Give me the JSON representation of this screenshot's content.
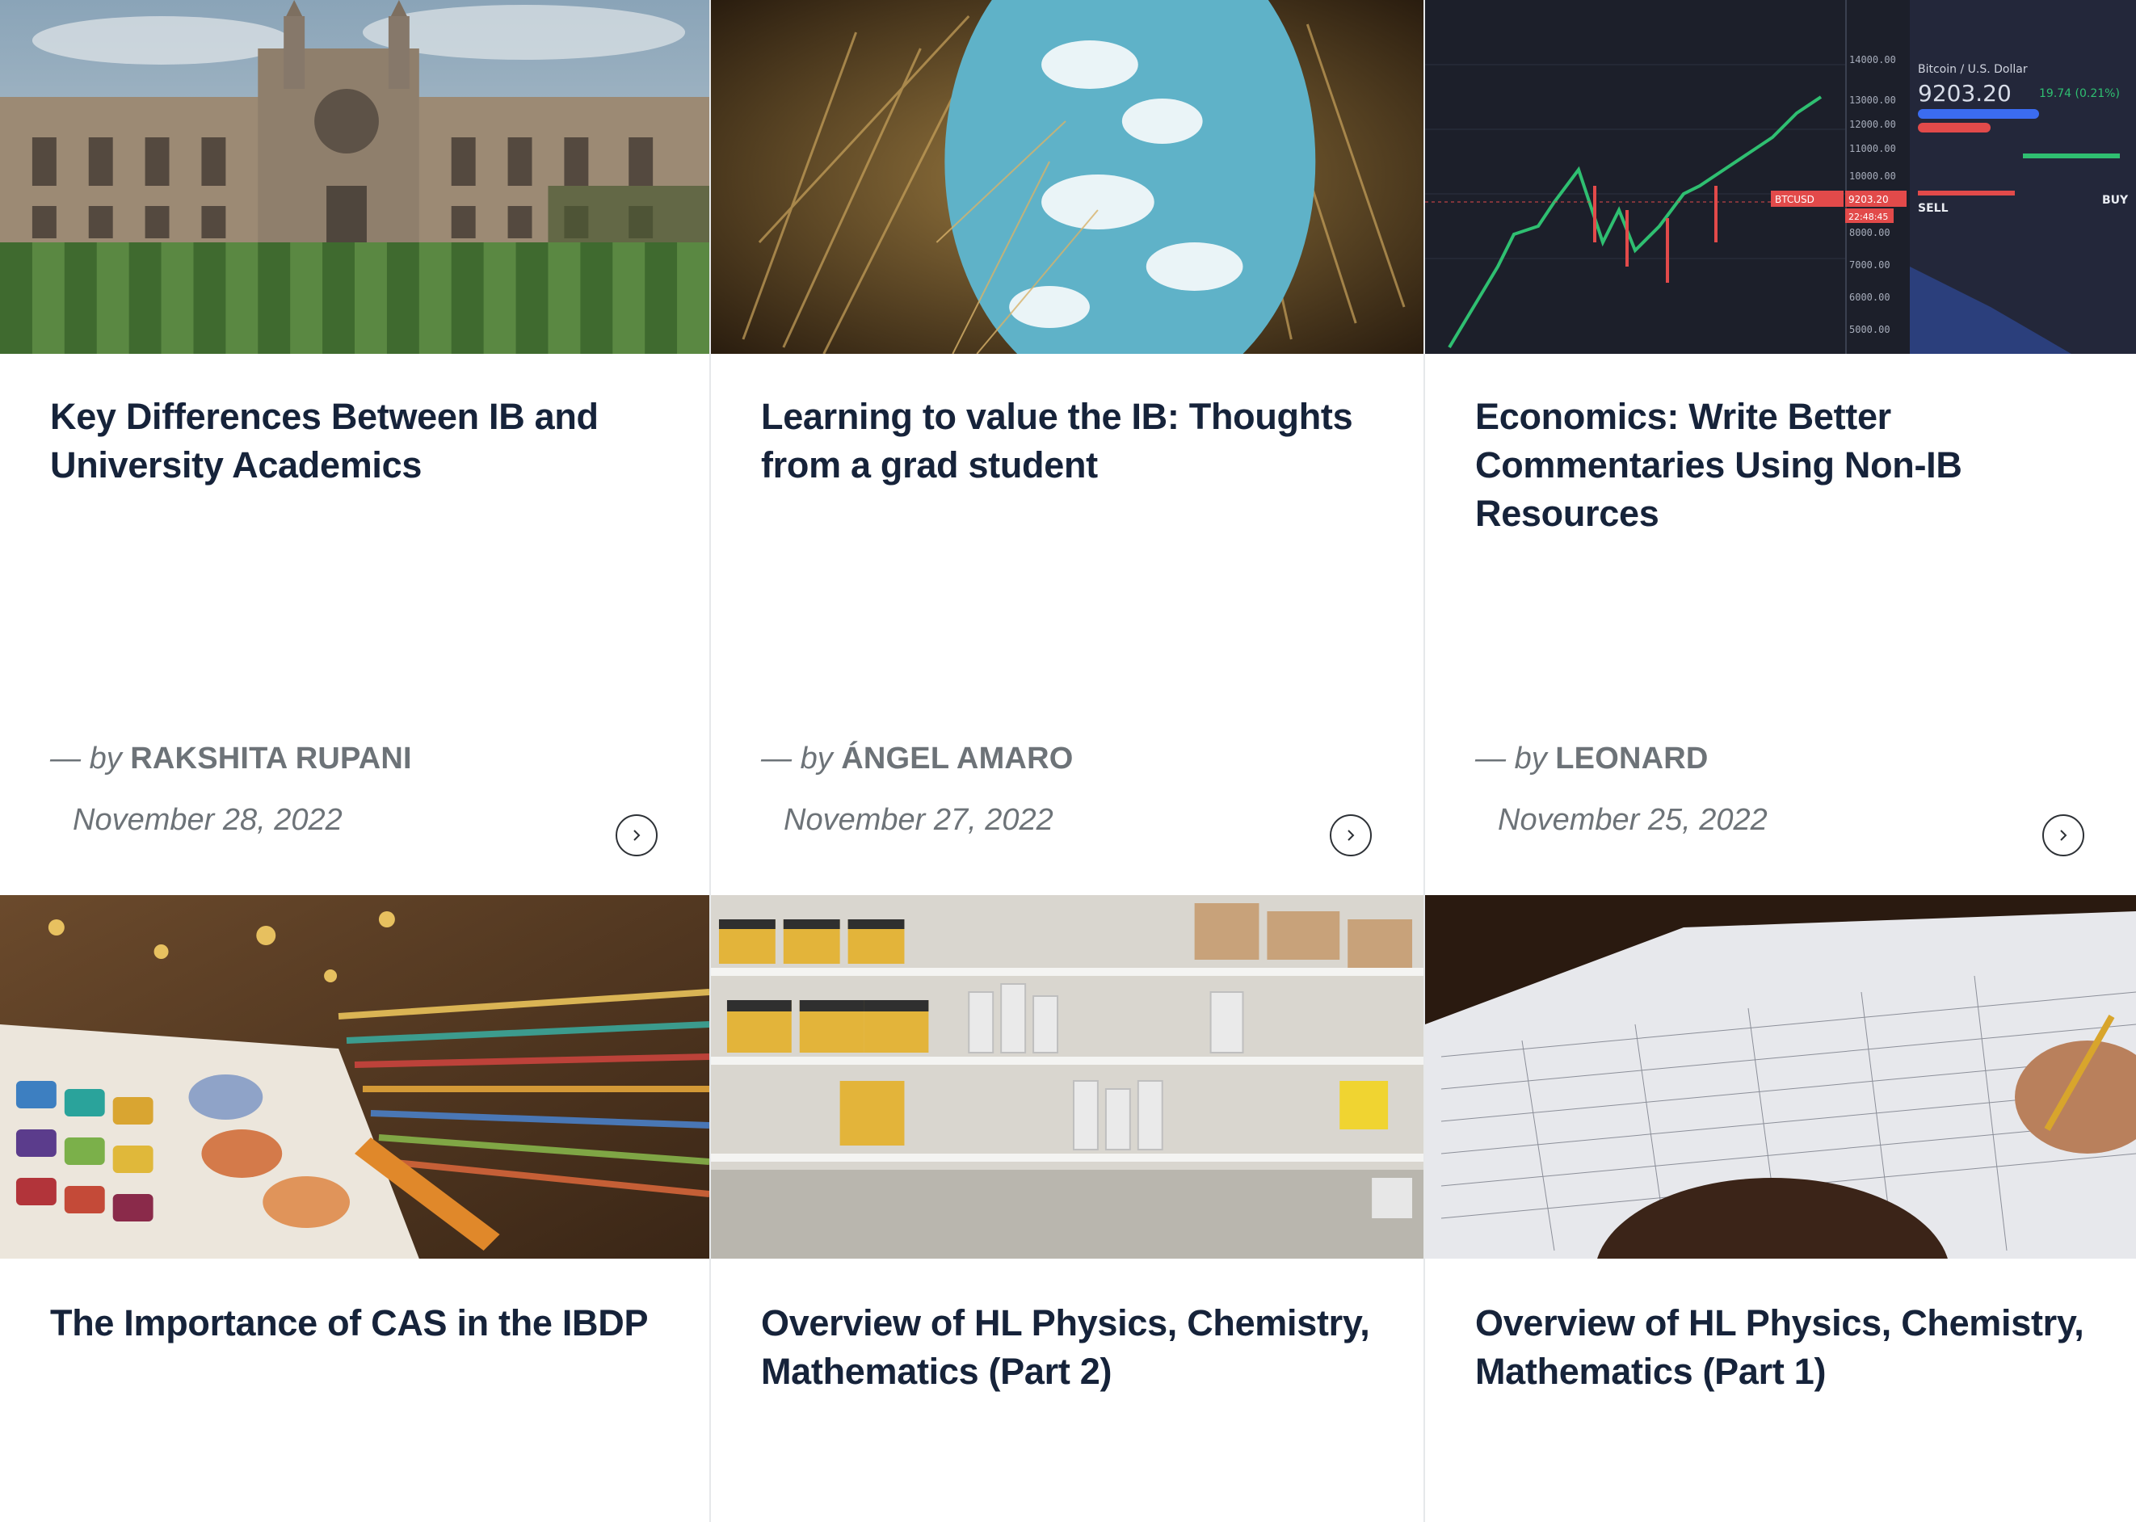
{
  "posts": [
    {
      "title": "Key Differences Between IB and University Academics",
      "by_prefix": "— ",
      "by_word": "by ",
      "author": "Rakshita Rupani",
      "date": "November 28, 2022",
      "image": "gothic-college-building-lawn"
    },
    {
      "title": "Learning to value the IB: Thoughts from a grad student",
      "by_prefix": "— ",
      "by_word": "by ",
      "author": "Ángel Amaro",
      "date": "November 27, 2022",
      "image": "sky-through-grass"
    },
    {
      "title": "Economics: Write Better Commentaries Using Non-IB Resources",
      "by_prefix": "— ",
      "by_word": "by ",
      "author": "Leonard",
      "date": "November 25, 2022",
      "image": "bitcoin-trading-chart",
      "chart_text": {
        "pair": "Bitcoin / U.S. Dollar",
        "price": "9203.20",
        "change": "19.74 (0.21%)",
        "ticker_tag": "BTCUSD",
        "tag_price": "9203.20",
        "tag_time": "22:48:45",
        "sell": "SELL",
        "buy": "BUY",
        "axis": [
          "14000.00",
          "13000.00",
          "12000.00",
          "11000.00",
          "10000.00",
          "8000.00",
          "7000.00",
          "6000.00",
          "5000.00"
        ]
      }
    },
    {
      "title": "The Importance of CAS in the IBDP",
      "image": "paint-palette-and-brush"
    },
    {
      "title": "Overview of HL Physics, Chemistry, Mathematics (Part 2)",
      "image": "laboratory-shelves"
    },
    {
      "title": "Overview of HL Physics, Chemistry, Mathematics (Part 1)",
      "image": "student-writing-worksheet"
    }
  ],
  "colors": {
    "title": "#16233a",
    "meta": "#6d7378",
    "divider": "#e6e8ea"
  },
  "icons": {
    "read_more": "chevron-right-circle-icon"
  }
}
